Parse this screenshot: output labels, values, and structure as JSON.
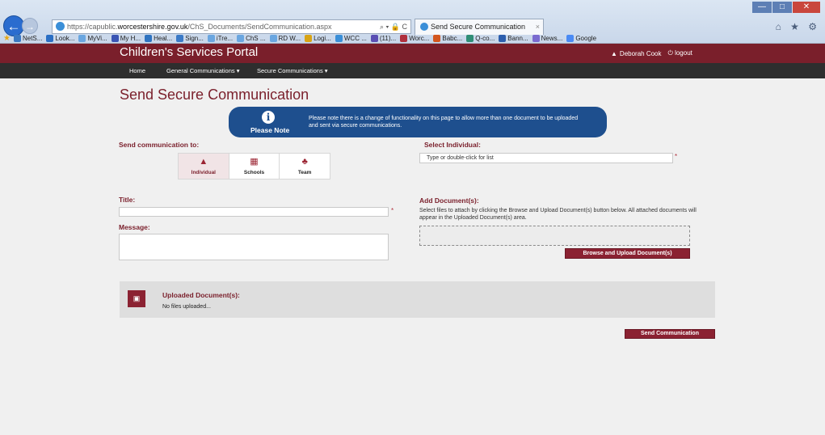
{
  "browser": {
    "url_prefix": "https://capublic.",
    "url_domain": "worcestershire.gov.uk",
    "url_path": "/ChS_Documents/SendCommunication.aspx",
    "url_icons": "⌕ ▾ 🔒 C",
    "tab_title": "Send Secure Communication",
    "tab_close": "×",
    "window_controls": [
      "—",
      "□",
      "✕"
    ],
    "toolbar_icons": "⌂ ★ ⚙",
    "favorites": [
      {
        "label": "NetS...",
        "color": "#3a78c2"
      },
      {
        "label": "Look...",
        "color": "#2b6fc4"
      },
      {
        "label": "MyVi...",
        "color": "#6aa6e0"
      },
      {
        "label": "My H...",
        "color": "#3a55b4"
      },
      {
        "label": "Heal...",
        "color": "#2f73c0"
      },
      {
        "label": "Sign...",
        "color": "#3b7ac7"
      },
      {
        "label": "iTre...",
        "color": "#6aa6e0"
      },
      {
        "label": "ChS ...",
        "color": "#6aa6e0"
      },
      {
        "label": "RD W...",
        "color": "#6aa6e0"
      },
      {
        "label": "Logi...",
        "color": "#d8a416"
      },
      {
        "label": "WCC ...",
        "color": "#3a8fd8"
      },
      {
        "label": "(11)...",
        "color": "#5a4fb3"
      },
      {
        "label": "Worc...",
        "color": "#b0303d"
      },
      {
        "label": "Babc...",
        "color": "#d3571e"
      },
      {
        "label": "Q-co...",
        "color": "#2f8e76"
      },
      {
        "label": "Bann...",
        "color": "#2d5fae"
      },
      {
        "label": "News...",
        "color": "#7a6bd0"
      },
      {
        "label": "Google",
        "color": "#4a8af4"
      }
    ]
  },
  "header": {
    "portal_title": "Children's Services Portal",
    "user_name": "Deborah Cook",
    "logout_label": "logout"
  },
  "nav": {
    "home": "Home",
    "general": "General Communications ▾",
    "secure": "Secure Communications ▾"
  },
  "main": {
    "page_title": "Send Secure Communication",
    "notice": {
      "label": "Please Note",
      "text": "Please note there is a change of functionality on this page to allow more than one document to be uploaded and sent via secure communications."
    },
    "send_to_label": "Send communication to:",
    "recipients": [
      {
        "label": "Individual",
        "icon": "▲"
      },
      {
        "label": "Schools",
        "icon": "▦"
      },
      {
        "label": "Team",
        "icon": "♣"
      }
    ],
    "select_individual_label": "Select Individual:",
    "select_individual_placeholder": "Type or double-click for list",
    "title_label": "Title:",
    "message_label": "Message:",
    "add_documents_label": "Add Document(s):",
    "add_documents_help": "Select files to attach by clicking the Browse and Upload Document(s) button below. All attached documents will appear in the Uploaded Document(s) area.",
    "browse_button": "Browse and Upload Document(s)",
    "uploaded_title": "Uploaded Document(s):",
    "uploaded_empty": "No files uploaded...",
    "send_button": "Send Communication",
    "required_mark": "*"
  }
}
